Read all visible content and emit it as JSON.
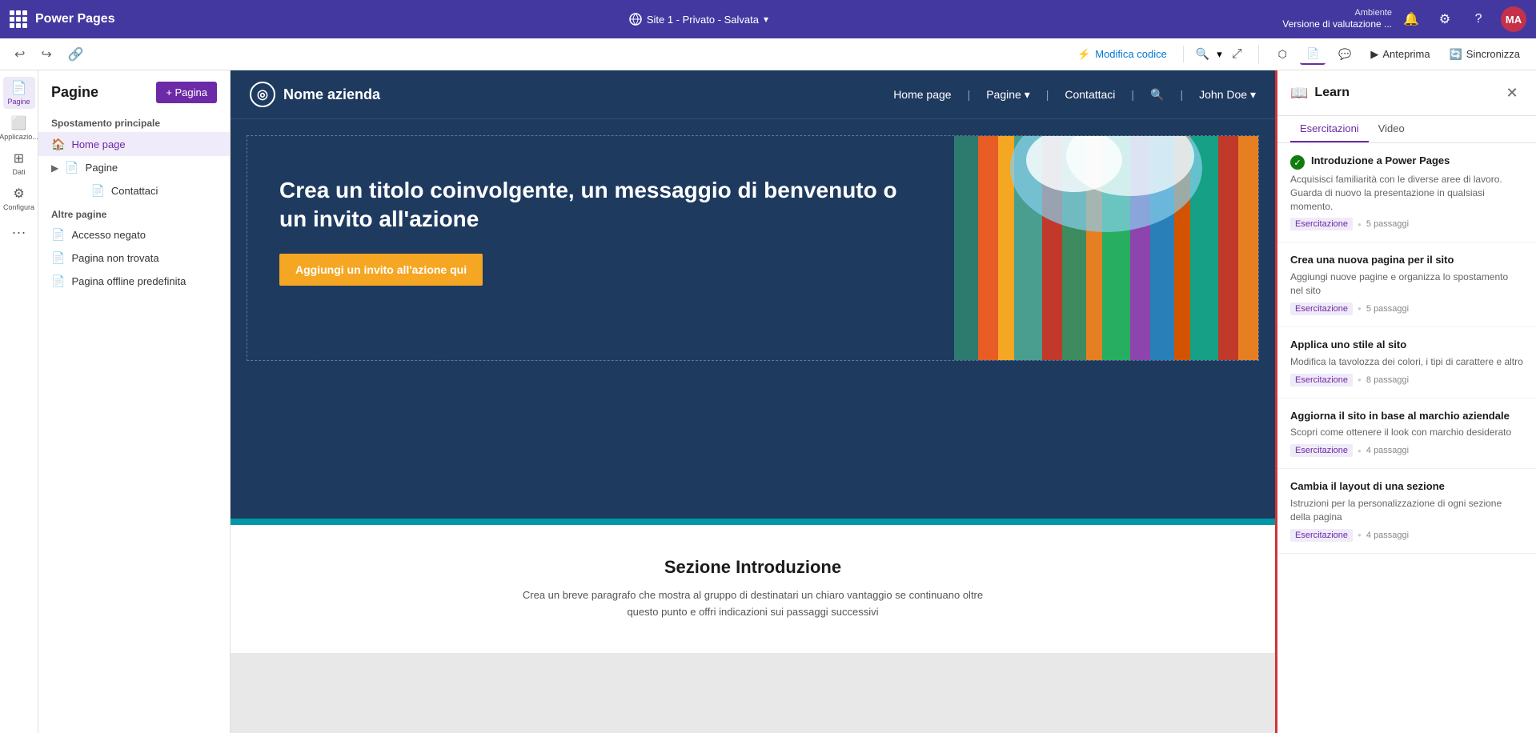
{
  "topNav": {
    "appTitle": "Power Pages",
    "siteInfo": "Site 1 - Privato - Salvata",
    "envLabel": "Ambiente",
    "envName": "Versione di valutazione ...",
    "avatar": "MA"
  },
  "secondToolbar": {
    "editCodeLabel": "Modifica codice",
    "previewLabel": "Anteprima",
    "syncLabel": "Sincronizza"
  },
  "sidebar": {
    "title": "Pagine",
    "addButton": "+ Pagina",
    "mainNavLabel": "Spostamento principale",
    "otherPagesLabel": "Altre pagine",
    "mainPages": [
      {
        "label": "Home page",
        "active": true
      },
      {
        "label": "Pagine",
        "active": false,
        "hasChildren": true
      },
      {
        "label": "Contattaci",
        "active": false
      }
    ],
    "otherPages": [
      {
        "label": "Accesso negato"
      },
      {
        "label": "Pagina non trovata"
      },
      {
        "label": "Pagina offline predefinita"
      }
    ]
  },
  "websitePreview": {
    "logoText": "Nome azienda",
    "navItems": [
      "Home page",
      "Pagine▾",
      "Contattaci",
      "🔍",
      "John Doe▾"
    ],
    "heroTitle": "Crea un titolo coinvolgente, un messaggio di benvenuto o un invito all'azione",
    "heroCta": "Aggiungi un invito all'azione qui",
    "introSectionTitle": "Sezione Introduzione",
    "introText": "Crea un breve paragrafo che mostra al gruppo di destinatari un chiaro vantaggio se continuano oltre questo punto e offri indicazioni sui passaggi successivi"
  },
  "learnPanel": {
    "title": "Learn",
    "tabs": [
      {
        "label": "Esercitazioni",
        "active": true
      },
      {
        "label": "Video",
        "active": false
      }
    ],
    "items": [
      {
        "title": "Introduzione a Power Pages",
        "desc": "Acquisisci familiarità con le diverse aree di lavoro. Guarda di nuovo la presentazione in qualsiasi momento.",
        "badge": "Esercitazione",
        "steps": "5 passaggi",
        "completed": true
      },
      {
        "title": "Crea una nuova pagina per il sito",
        "desc": "Aggiungi nuove pagine e organizza lo spostamento nel sito",
        "badge": "Esercitazione",
        "steps": "5 passaggi",
        "completed": false
      },
      {
        "title": "Applica uno stile al sito",
        "desc": "Modifica la tavolozza dei colori, i tipi di carattere e altro",
        "badge": "Esercitazione",
        "steps": "8 passaggi",
        "completed": false
      },
      {
        "title": "Aggiorna il sito in base al marchio aziendale",
        "desc": "Scopri come ottenere il look con marchio desiderato",
        "badge": "Esercitazione",
        "steps": "4 passaggi",
        "completed": false
      },
      {
        "title": "Cambia il layout di una sezione",
        "desc": "Istruzioni per la personalizzazione di ogni sezione della pagina",
        "badge": "Esercitazione",
        "steps": "4 passaggi",
        "completed": false
      }
    ]
  }
}
